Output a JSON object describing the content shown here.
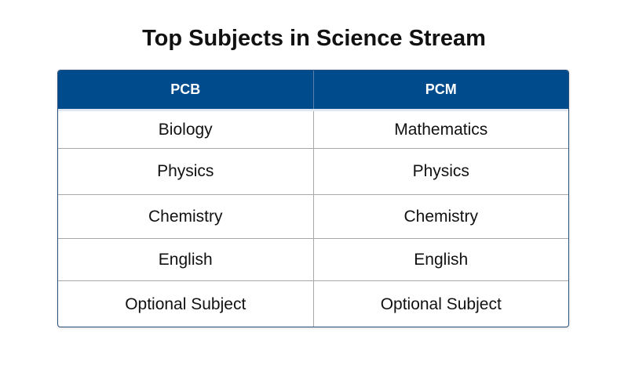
{
  "title": "Top Subjects in Science Stream",
  "table": {
    "headers": [
      "PCB",
      "PCM"
    ],
    "rows": [
      [
        "Biology",
        "Mathematics"
      ],
      [
        "Physics",
        "Physics"
      ],
      [
        "Chemistry",
        "Chemistry"
      ],
      [
        "English",
        "English"
      ],
      [
        "Optional Subject",
        "Optional Subject"
      ]
    ]
  },
  "colors": {
    "header_background": "#004b8c",
    "header_text": "#ffffff"
  }
}
